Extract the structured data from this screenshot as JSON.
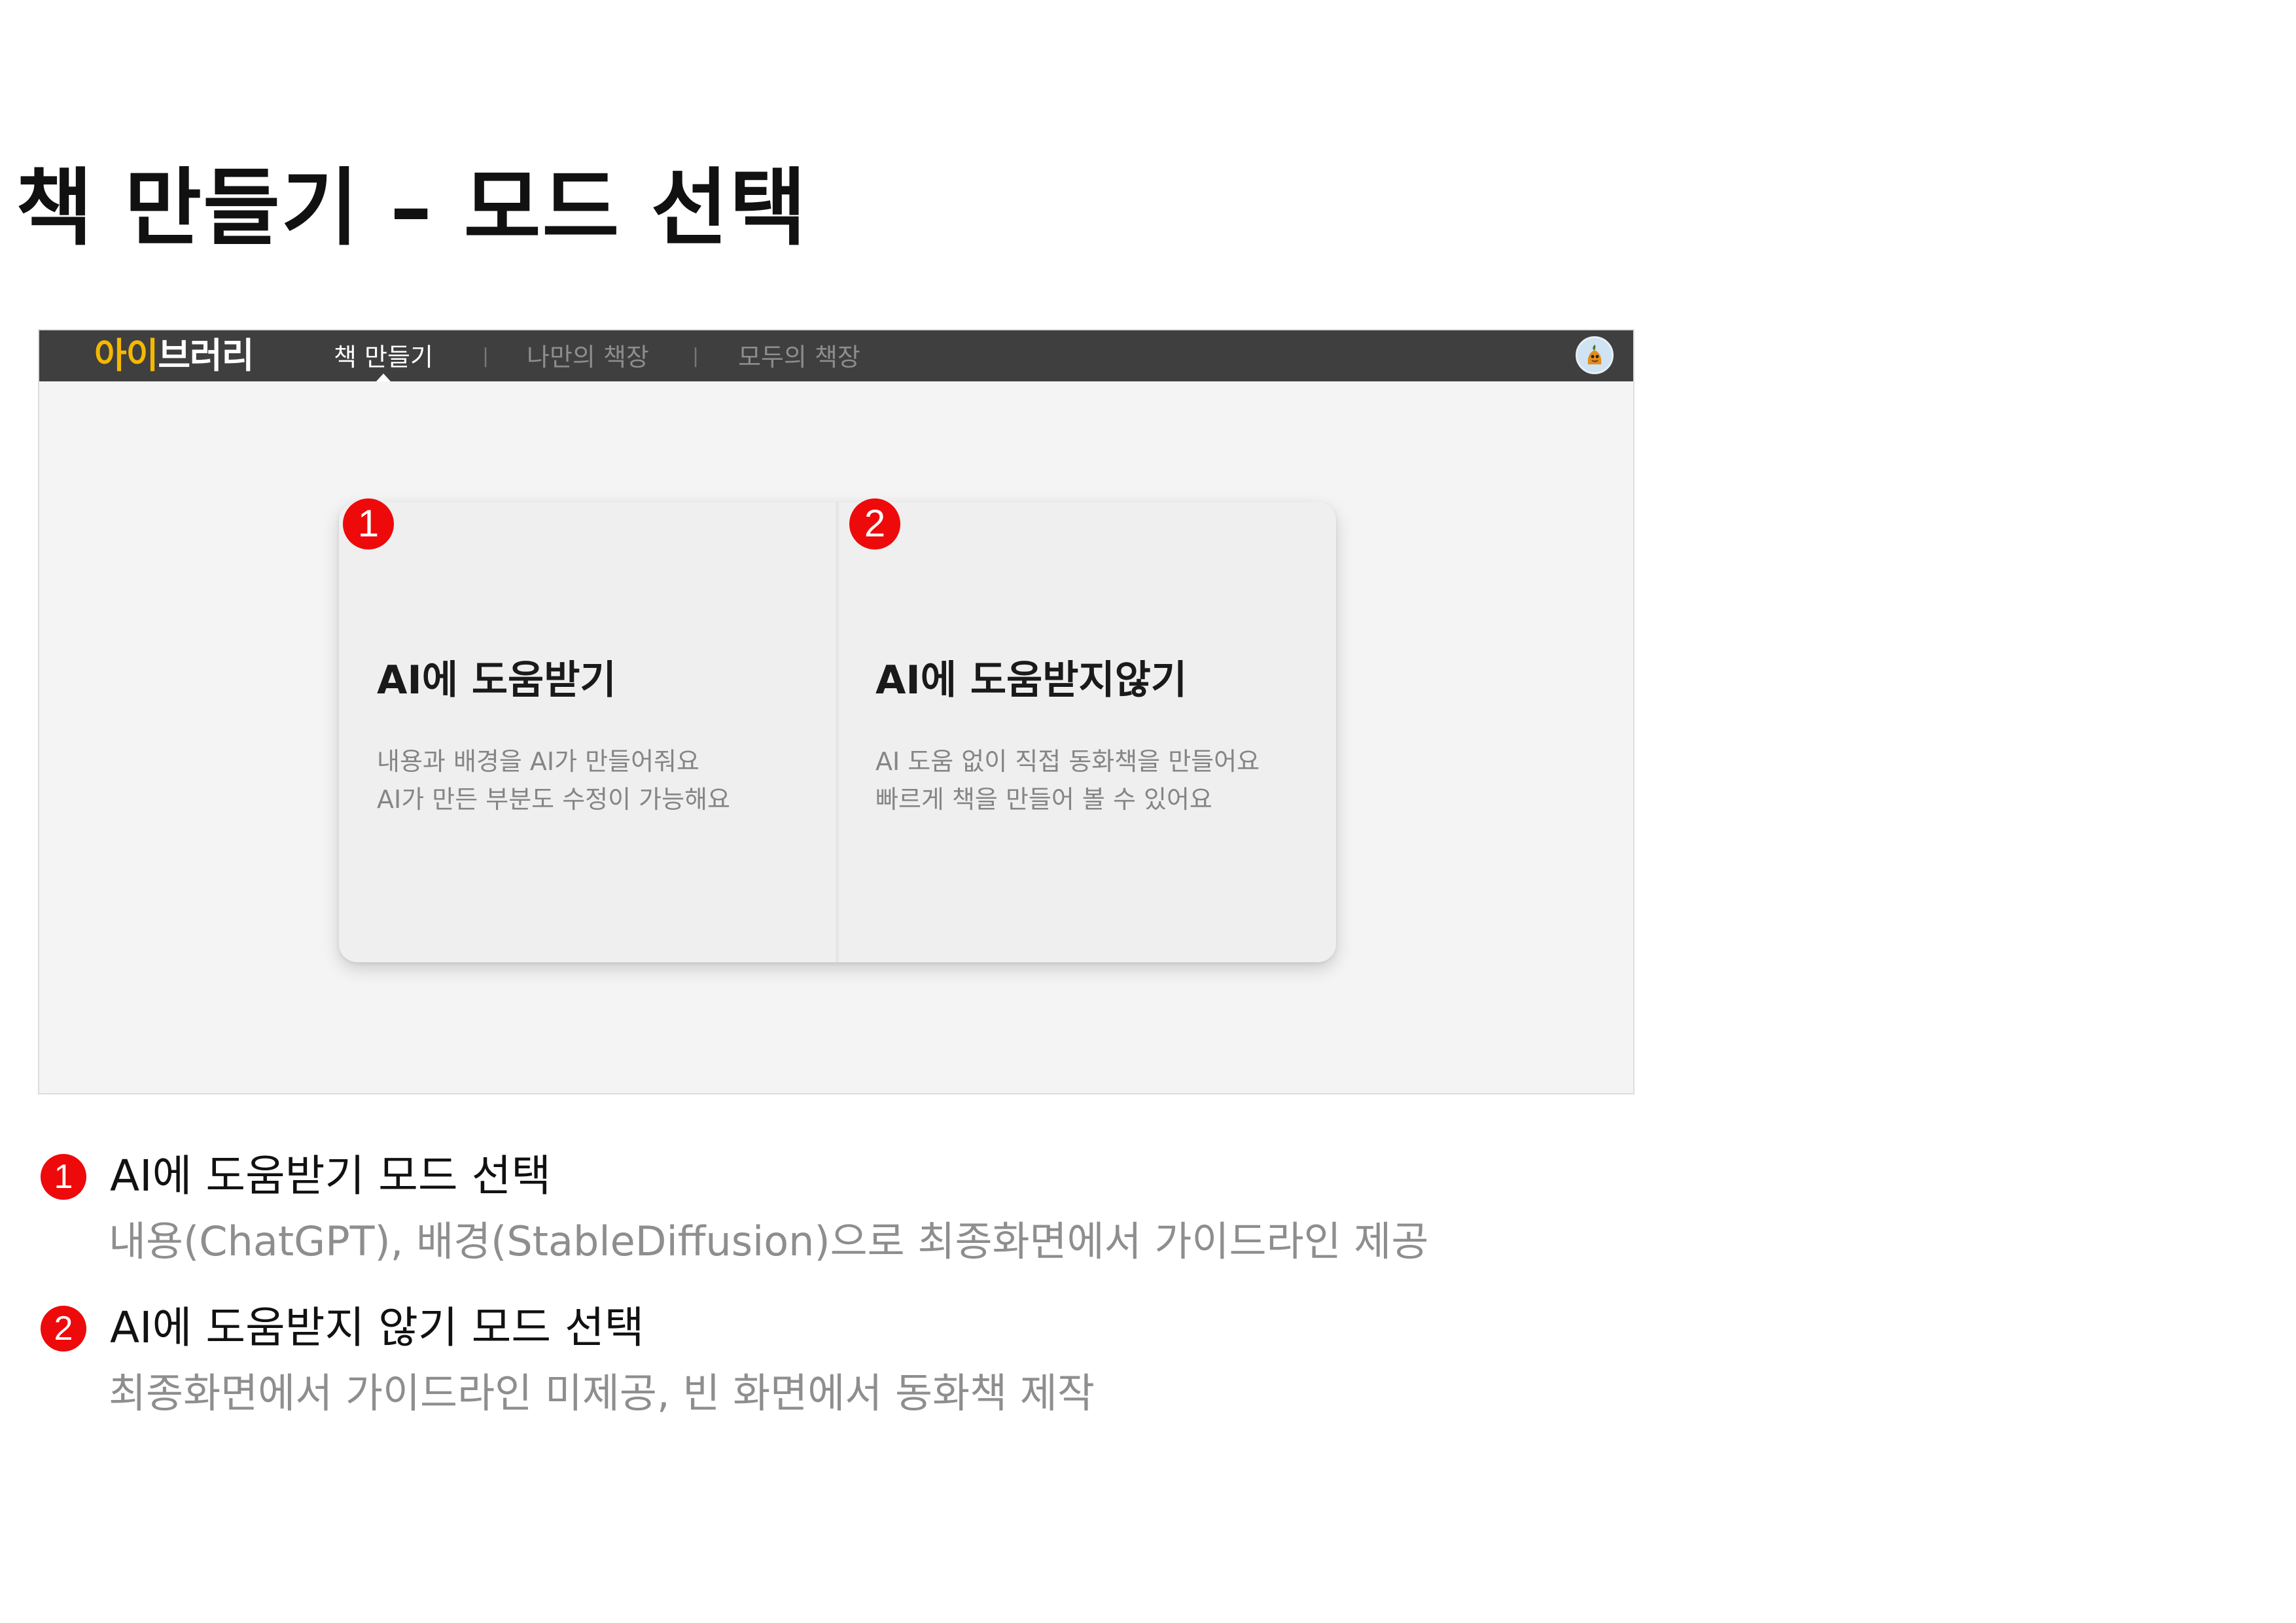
{
  "page": {
    "title": "책 만들기 – 모드 선택"
  },
  "app": {
    "logo": {
      "accent": "아이",
      "rest": "브러리",
      "accent_color": "#f5b800"
    },
    "nav": {
      "items": [
        {
          "label": "책 만들기",
          "active": true
        },
        {
          "label": "나만의 책장",
          "active": false
        },
        {
          "label": "모두의 책장",
          "active": false
        }
      ],
      "separator": "|"
    },
    "avatar": {
      "icon": "user-avatar-icon"
    }
  },
  "cards": [
    {
      "number": "1",
      "title": "AI에 도움받기",
      "desc_lines": [
        "내용과 배경을 AI가 만들어줘요",
        "AI가 만든 부분도 수정이 가능해요"
      ]
    },
    {
      "number": "2",
      "title": "AI에 도움받지않기",
      "desc_lines": [
        "AI 도움 없이 직접 동화책을 만들어요",
        "빠르게 책을 만들어 볼 수 있어요"
      ]
    }
  ],
  "explanations": [
    {
      "number": "1",
      "heading": "AI에 도움받기 모드 선택",
      "desc": "내용(ChatGPT), 배경(StableDiffusion)으로 최종화면에서 가이드라인 제공"
    },
    {
      "number": "2",
      "heading": "AI에 도움받지 않기 모드 선택",
      "desc": "최종화면에서 가이드라인 미제공, 빈 화면에서 동화책 제작"
    }
  ],
  "colors": {
    "badge": "#ee0a0a",
    "navbar": "#3f3f3f",
    "canvas": "#f4f4f4"
  }
}
